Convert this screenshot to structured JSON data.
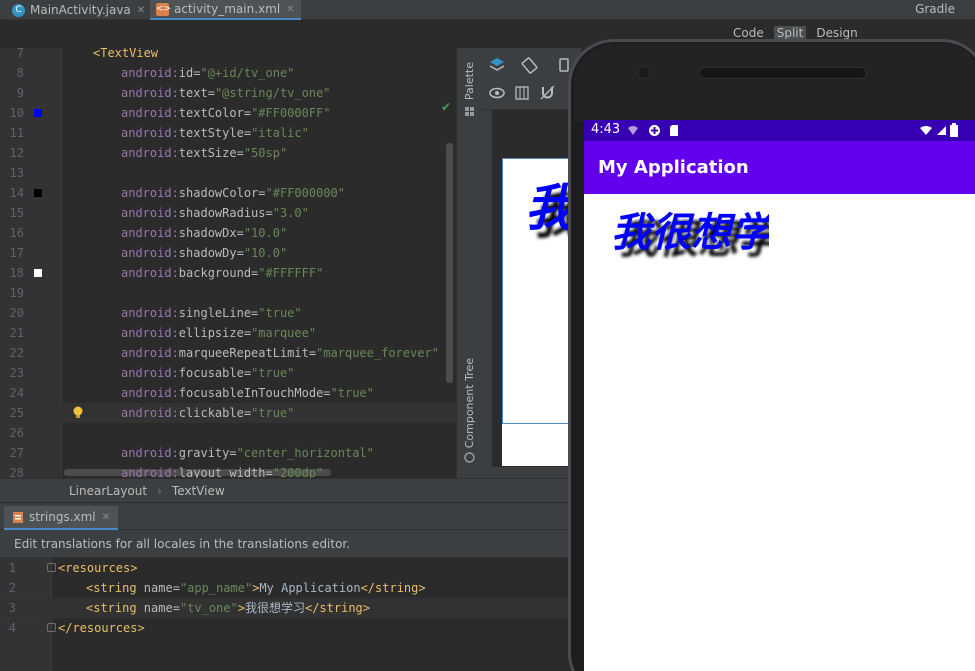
{
  "tabs": [
    {
      "label": "MainActivity.java",
      "icon": "java-class-icon"
    },
    {
      "label": "activity_main.xml",
      "icon": "xml-layout-icon",
      "active": true
    }
  ],
  "right_tab": "Gradle",
  "modes": [
    "Code",
    "Split",
    "Design"
  ],
  "editor": {
    "lines": [
      {
        "n": "7",
        "text": "<TextView"
      },
      {
        "n": "8",
        "ns": "android:",
        "attr": "id",
        "val": "\"@+id/tv_one\""
      },
      {
        "n": "9",
        "ns": "android:",
        "attr": "text",
        "val": "\"@string/tv_one\""
      },
      {
        "n": "10",
        "ns": "android:",
        "attr": "textColor",
        "val": "\"#FF0000FF\"",
        "swatch": "#0000ff"
      },
      {
        "n": "11",
        "ns": "android:",
        "attr": "textStyle",
        "val": "\"italic\""
      },
      {
        "n": "12",
        "ns": "android:",
        "attr": "textSize",
        "val": "\"50sp\""
      },
      {
        "n": "13"
      },
      {
        "n": "14",
        "ns": "android:",
        "attr": "shadowColor",
        "val": "\"#FF000000\"",
        "swatch": "#000000"
      },
      {
        "n": "15",
        "ns": "android:",
        "attr": "shadowRadius",
        "val": "\"3.0\""
      },
      {
        "n": "16",
        "ns": "android:",
        "attr": "shadowDx",
        "val": "\"10.0\""
      },
      {
        "n": "17",
        "ns": "android:",
        "attr": "shadowDy",
        "val": "\"10.0\""
      },
      {
        "n": "18",
        "ns": "android:",
        "attr": "background",
        "val": "\"#FFFFFF\"",
        "swatch": "#ffffff"
      },
      {
        "n": "19"
      },
      {
        "n": "20",
        "ns": "android:",
        "attr": "singleLine",
        "val": "\"true\""
      },
      {
        "n": "21",
        "ns": "android:",
        "attr": "ellipsize",
        "val": "\"marquee\""
      },
      {
        "n": "22",
        "ns": "android:",
        "attr": "marqueeRepeatLimit",
        "val": "\"marquee_forever\""
      },
      {
        "n": "23",
        "ns": "android:",
        "attr": "focusable",
        "val": "\"true\""
      },
      {
        "n": "24",
        "ns": "android:",
        "attr": "focusableInTouchMode",
        "val": "\"true\""
      },
      {
        "n": "25",
        "ns": "android:",
        "attr": "clickable",
        "val": "\"true\"",
        "current": true
      },
      {
        "n": "26"
      },
      {
        "n": "27",
        "ns": "android:",
        "attr": "gravity",
        "val": "\"center_horizontal\""
      },
      {
        "n": "28",
        "ns": "android:",
        "attr": "layout_width",
        "val": "\"200dp\""
      }
    ]
  },
  "side_panels": {
    "palette": "Palette",
    "component_tree": "Component Tree"
  },
  "breadcrumb": [
    "LinearLayout",
    "TextView"
  ],
  "design_preview_text": "我很",
  "strings_tab": "strings.xml",
  "translations_notice": "Edit translations for all locales in the translations editor.",
  "strings_lines": [
    {
      "n": "1",
      "open": "<resources>"
    },
    {
      "n": "2",
      "tag_open": "<string ",
      "attr": "name",
      "val": "\"app_name\"",
      "text": "My Application",
      "tag_close": "</string>"
    },
    {
      "n": "3",
      "tag_open": "<string ",
      "attr": "name",
      "val": "\"tv_one\"",
      "text": "我很想学习",
      "tag_close": "</string>",
      "current": true
    },
    {
      "n": "4",
      "open": "</resources>"
    }
  ],
  "phone": {
    "time": "4:43",
    "app_title": "My Application",
    "textview_text": "我很想学"
  },
  "colors": {
    "status_bar": "#3700b3",
    "app_bar": "#6200ee",
    "text_blue": "#0000ff"
  }
}
